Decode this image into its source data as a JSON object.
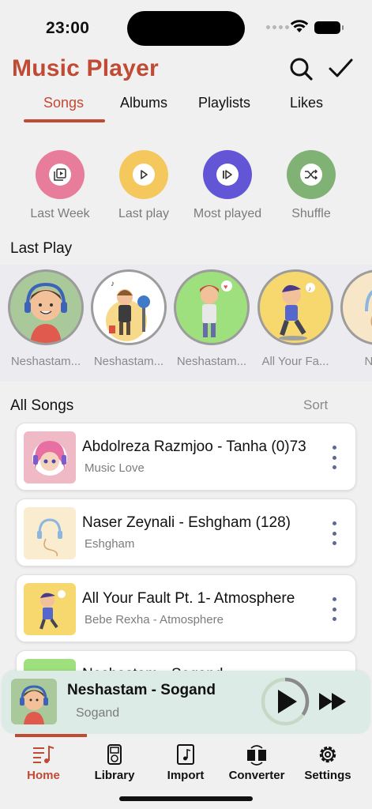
{
  "status_bar": {
    "time": "23:00"
  },
  "header": {
    "title": "Music Player",
    "search_icon": "search-icon",
    "check_icon": "checkmark-icon"
  },
  "tabs": [
    {
      "label": "Songs",
      "active": true
    },
    {
      "label": "Albums",
      "active": false
    },
    {
      "label": "Playlists",
      "active": false
    },
    {
      "label": "Likes",
      "active": false
    }
  ],
  "quick_actions": [
    {
      "label": "Last Week",
      "color": "#e77c9b",
      "icon": "video-library-icon"
    },
    {
      "label": "Last play",
      "color": "#f4c85d",
      "icon": "play-icon"
    },
    {
      "label": "Most played",
      "color": "#6356d6",
      "icon": "play-step-icon"
    },
    {
      "label": "Shuffle",
      "color": "#7fb274",
      "icon": "shuffle-icon"
    }
  ],
  "last_play": {
    "title": "Last Play",
    "items": [
      {
        "label": "Neshastam..."
      },
      {
        "label": "Neshastam..."
      },
      {
        "label": "Neshastam..."
      },
      {
        "label": "All Your Fa..."
      },
      {
        "label": "Nase"
      }
    ]
  },
  "all_songs": {
    "title": "All Songs",
    "sort_label": "Sort",
    "items": [
      {
        "title": "Abdolreza Razmjoo - Tanha (0)73",
        "subtitle": "Music Love"
      },
      {
        "title": "Naser Zeynali - Eshgham (128)",
        "subtitle": "Eshgham"
      },
      {
        "title": "All Your Fault Pt. 1- Atmosphere",
        "subtitle": "Bebe Rexha - Atmosphere"
      },
      {
        "title": "Neshastam - Sogand",
        "subtitle": ""
      }
    ]
  },
  "mini_player": {
    "title": "Neshastam - Sogand",
    "subtitle": "Sogand",
    "progress": 0.35
  },
  "bottom_nav": [
    {
      "label": "Home",
      "active": true
    },
    {
      "label": "Library",
      "active": false
    },
    {
      "label": "Import",
      "active": false
    },
    {
      "label": "Converter",
      "active": false
    },
    {
      "label": "Settings",
      "active": false
    }
  ],
  "colors": {
    "accent": "#c04a34",
    "background": "#f1f0f0",
    "mini_player_bg": "#dcebe6"
  }
}
